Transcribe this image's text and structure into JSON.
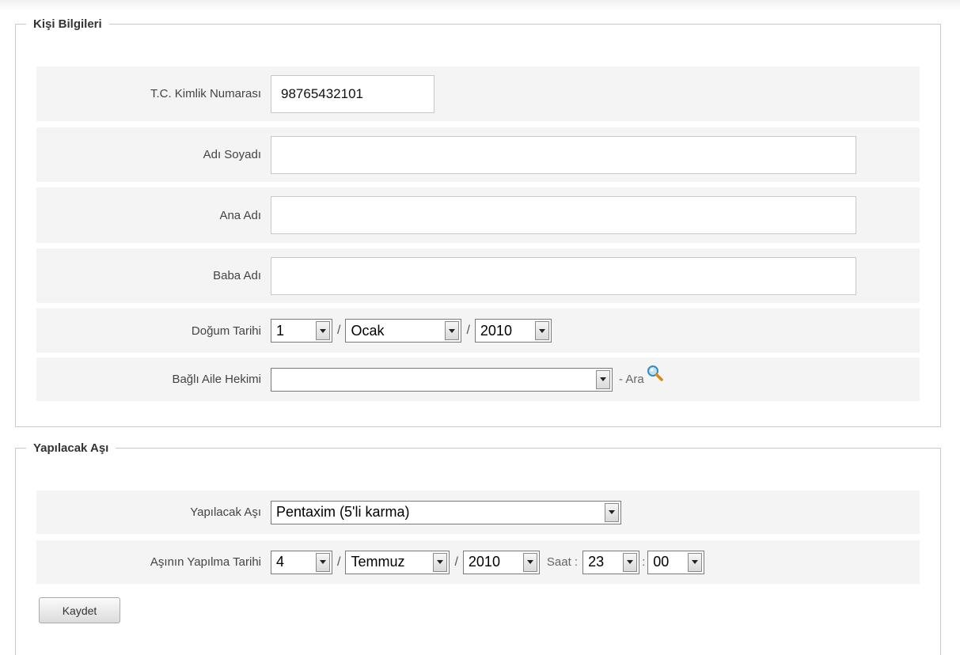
{
  "person_section": {
    "legend": "Kişi Bilgileri",
    "tc_label": "T.C. Kimlik Numarası",
    "tc_value": "98765432101",
    "name_label": "Adı Soyadı",
    "name_value": "",
    "mother_label": "Ana Adı",
    "mother_value": "",
    "father_label": "Baba Adı",
    "father_value": "",
    "birth_label": "Doğum Tarihi",
    "birth_day": "1",
    "birth_month": "Ocak",
    "birth_year": "2010",
    "date_sep": "/",
    "doctor_label": "Bağlı Aile Hekimi",
    "doctor_value": "",
    "search_text": "- Ara",
    "search_icon": "magnifier-icon"
  },
  "vaccine_section": {
    "legend": "Yapılacak Aşı",
    "vaccine_label": "Yapılacak Aşı",
    "vaccine_value": "Pentaxim (5'li karma)",
    "date_label": "Aşının Yapılma Tarihi",
    "day": "4",
    "month": "Temmuz",
    "year": "2010",
    "date_sep": "/",
    "time_label": "Saat :",
    "hour": "23",
    "time_sep": ":",
    "minute": "00",
    "save_button": "Kaydet"
  }
}
